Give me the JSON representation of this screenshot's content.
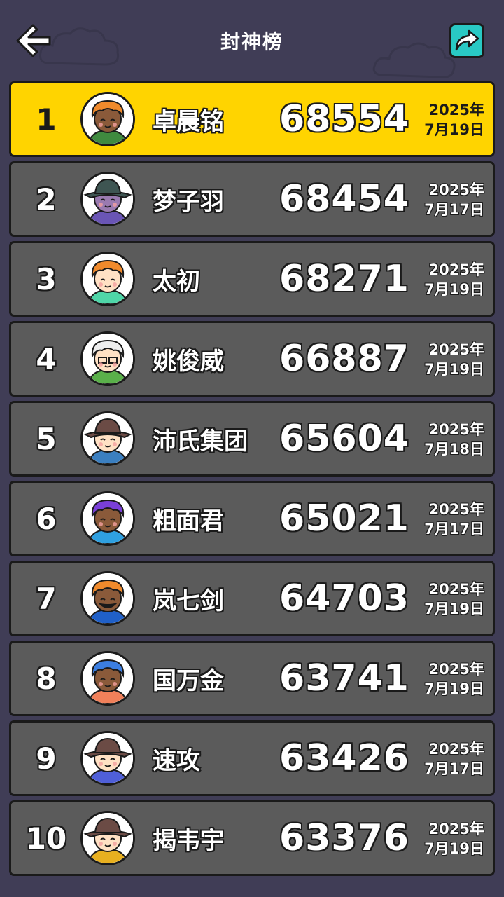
{
  "header": {
    "title": "封神榜",
    "back_icon": "arrow-left-icon",
    "share_icon": "share-arrow-icon",
    "share_color": "#29c9c4"
  },
  "colors": {
    "background": "#403d56",
    "row_default": "#5b5b5b",
    "row_highlight": "#ffd400"
  },
  "rows": [
    {
      "rank": "1",
      "name": "卓晨铭",
      "score": "68554",
      "date_line1": "2025年",
      "date_line2": "7月19日",
      "avatar": "monkey-sleepy-green",
      "hair": "#f08a2c",
      "face": "#8a5a3a",
      "shirt": "#3f8a3f"
    },
    {
      "rank": "2",
      "name": "梦子羽",
      "score": "68454",
      "date_line1": "2025年",
      "date_line2": "7月17日",
      "avatar": "hat-ninja-purple",
      "hair": "#3e5552",
      "face": "#9a7ab0",
      "shirt": "#6a55b5"
    },
    {
      "rank": "3",
      "name": "太初",
      "score": "68271",
      "date_line1": "2025年",
      "date_line2": "7月19日",
      "avatar": "smiling-orange-mint",
      "hair": "#f08a2c",
      "face": "#ffe1c4",
      "shirt": "#4fd6a8"
    },
    {
      "rank": "4",
      "name": "姚俊威",
      "score": "66887",
      "date_line1": "2025年",
      "date_line2": "7月19日",
      "avatar": "white-hair-glasses",
      "hair": "#eeeeee",
      "face": "#ffe1c4",
      "shirt": "#5ab04a"
    },
    {
      "rank": "5",
      "name": "沛氏集团",
      "score": "65604",
      "date_line1": "2025年",
      "date_line2": "7月18日",
      "avatar": "brown-hat-blue",
      "hair": "#6b4b45",
      "face": "#ffe1c4",
      "shirt": "#3b7fc0"
    },
    {
      "rank": "6",
      "name": "粗面君",
      "score": "65021",
      "date_line1": "2025年",
      "date_line2": "7月17日",
      "avatar": "purple-hair-jacket",
      "hair": "#7a3fd8",
      "face": "#8a5a3a",
      "shirt": "#2fa0e0"
    },
    {
      "rank": "7",
      "name": "岚七剑",
      "score": "64703",
      "date_line1": "2025年",
      "date_line2": "7月19日",
      "avatar": "masked-orange-blue",
      "hair": "#f08a2c",
      "face": "#8a5a3a",
      "shirt": "#2060c8"
    },
    {
      "rank": "8",
      "name": "国万金",
      "score": "63741",
      "date_line1": "2025年",
      "date_line2": "7月19日",
      "avatar": "blue-hair-monkey",
      "hair": "#3c7ee0",
      "face": "#8a5a3a",
      "shirt": "#f0805a"
    },
    {
      "rank": "9",
      "name": "速攻",
      "score": "63426",
      "date_line1": "2025年",
      "date_line2": "7月17日",
      "avatar": "brown-hat-indigo",
      "hair": "#6b4b45",
      "face": "#ffe1c4",
      "shirt": "#4f5fd8"
    },
    {
      "rank": "10",
      "name": "揭韦宇",
      "score": "63376",
      "date_line1": "2025年",
      "date_line2": "7月19日",
      "avatar": "brown-hat-yellow",
      "hair": "#6b4b45",
      "face": "#ffe1c4",
      "shirt": "#e8b020"
    }
  ]
}
